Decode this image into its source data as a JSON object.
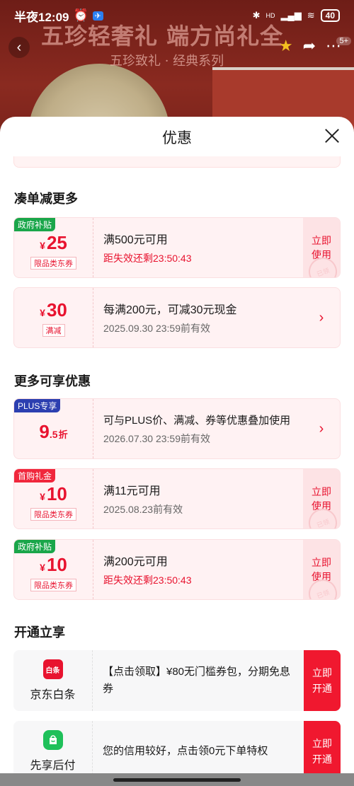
{
  "status_bar": {
    "time": "半夜12:09",
    "battery": "40",
    "network": "HD"
  },
  "background": {
    "title": "五珍轻奢礼 端方尚礼全",
    "subtitle": "五珍致礼 · 经典系列",
    "badge": "5+"
  },
  "sheet": {
    "title": "优惠"
  },
  "sections": {
    "more_discount": "凑单减更多",
    "more_offers": "更多可享优惠",
    "open_enjoy": "开通立享"
  },
  "coupons": [
    {
      "tag": "政府补贴",
      "tag_color": "green",
      "yen": "¥",
      "amount": "25",
      "sub": "限品类东券",
      "condition": "满500元可用",
      "expiry": "距失效还剩23:50:43",
      "expiry_red": true,
      "action": "立即使用"
    },
    {
      "tag": "",
      "yen": "¥",
      "amount": "30",
      "sub": "满减",
      "condition": "每满200元，可减30元现金",
      "expiry": "2025.09.30 23:59前有效",
      "expiry_red": false,
      "action": "›"
    },
    {
      "tag": "PLUS专享",
      "tag_color": "blue",
      "amount": "9",
      "decimal": ".5",
      "unit": "折",
      "condition": "可与PLUS价、满减、券等优惠叠加使用",
      "expiry": "2026.07.30 23:59前有效",
      "expiry_red": false,
      "action": "›"
    },
    {
      "tag": "首购礼金",
      "tag_color": "red",
      "yen": "¥",
      "amount": "10",
      "sub": "限品类东券",
      "condition": "满11元可用",
      "expiry": "2025.08.23前有效",
      "expiry_red": false,
      "action": "立即使用"
    },
    {
      "tag": "政府补贴",
      "tag_color": "green",
      "yen": "¥",
      "amount": "10",
      "sub": "限品类东券",
      "condition": "满200元可用",
      "expiry": "距失效还剩23:50:43",
      "expiry_red": true,
      "action": "立即使用"
    }
  ],
  "services": [
    {
      "icon_text": "白条",
      "name": "京东白条",
      "desc": "【点击领取】¥80无门槛券包，分期免息券",
      "cta": "立即开通"
    },
    {
      "icon_text": "",
      "name": "先享后付",
      "desc": "您的信用较好，点击领0元下单特权",
      "cta": "立即开通"
    }
  ],
  "stamp_text": "已领"
}
